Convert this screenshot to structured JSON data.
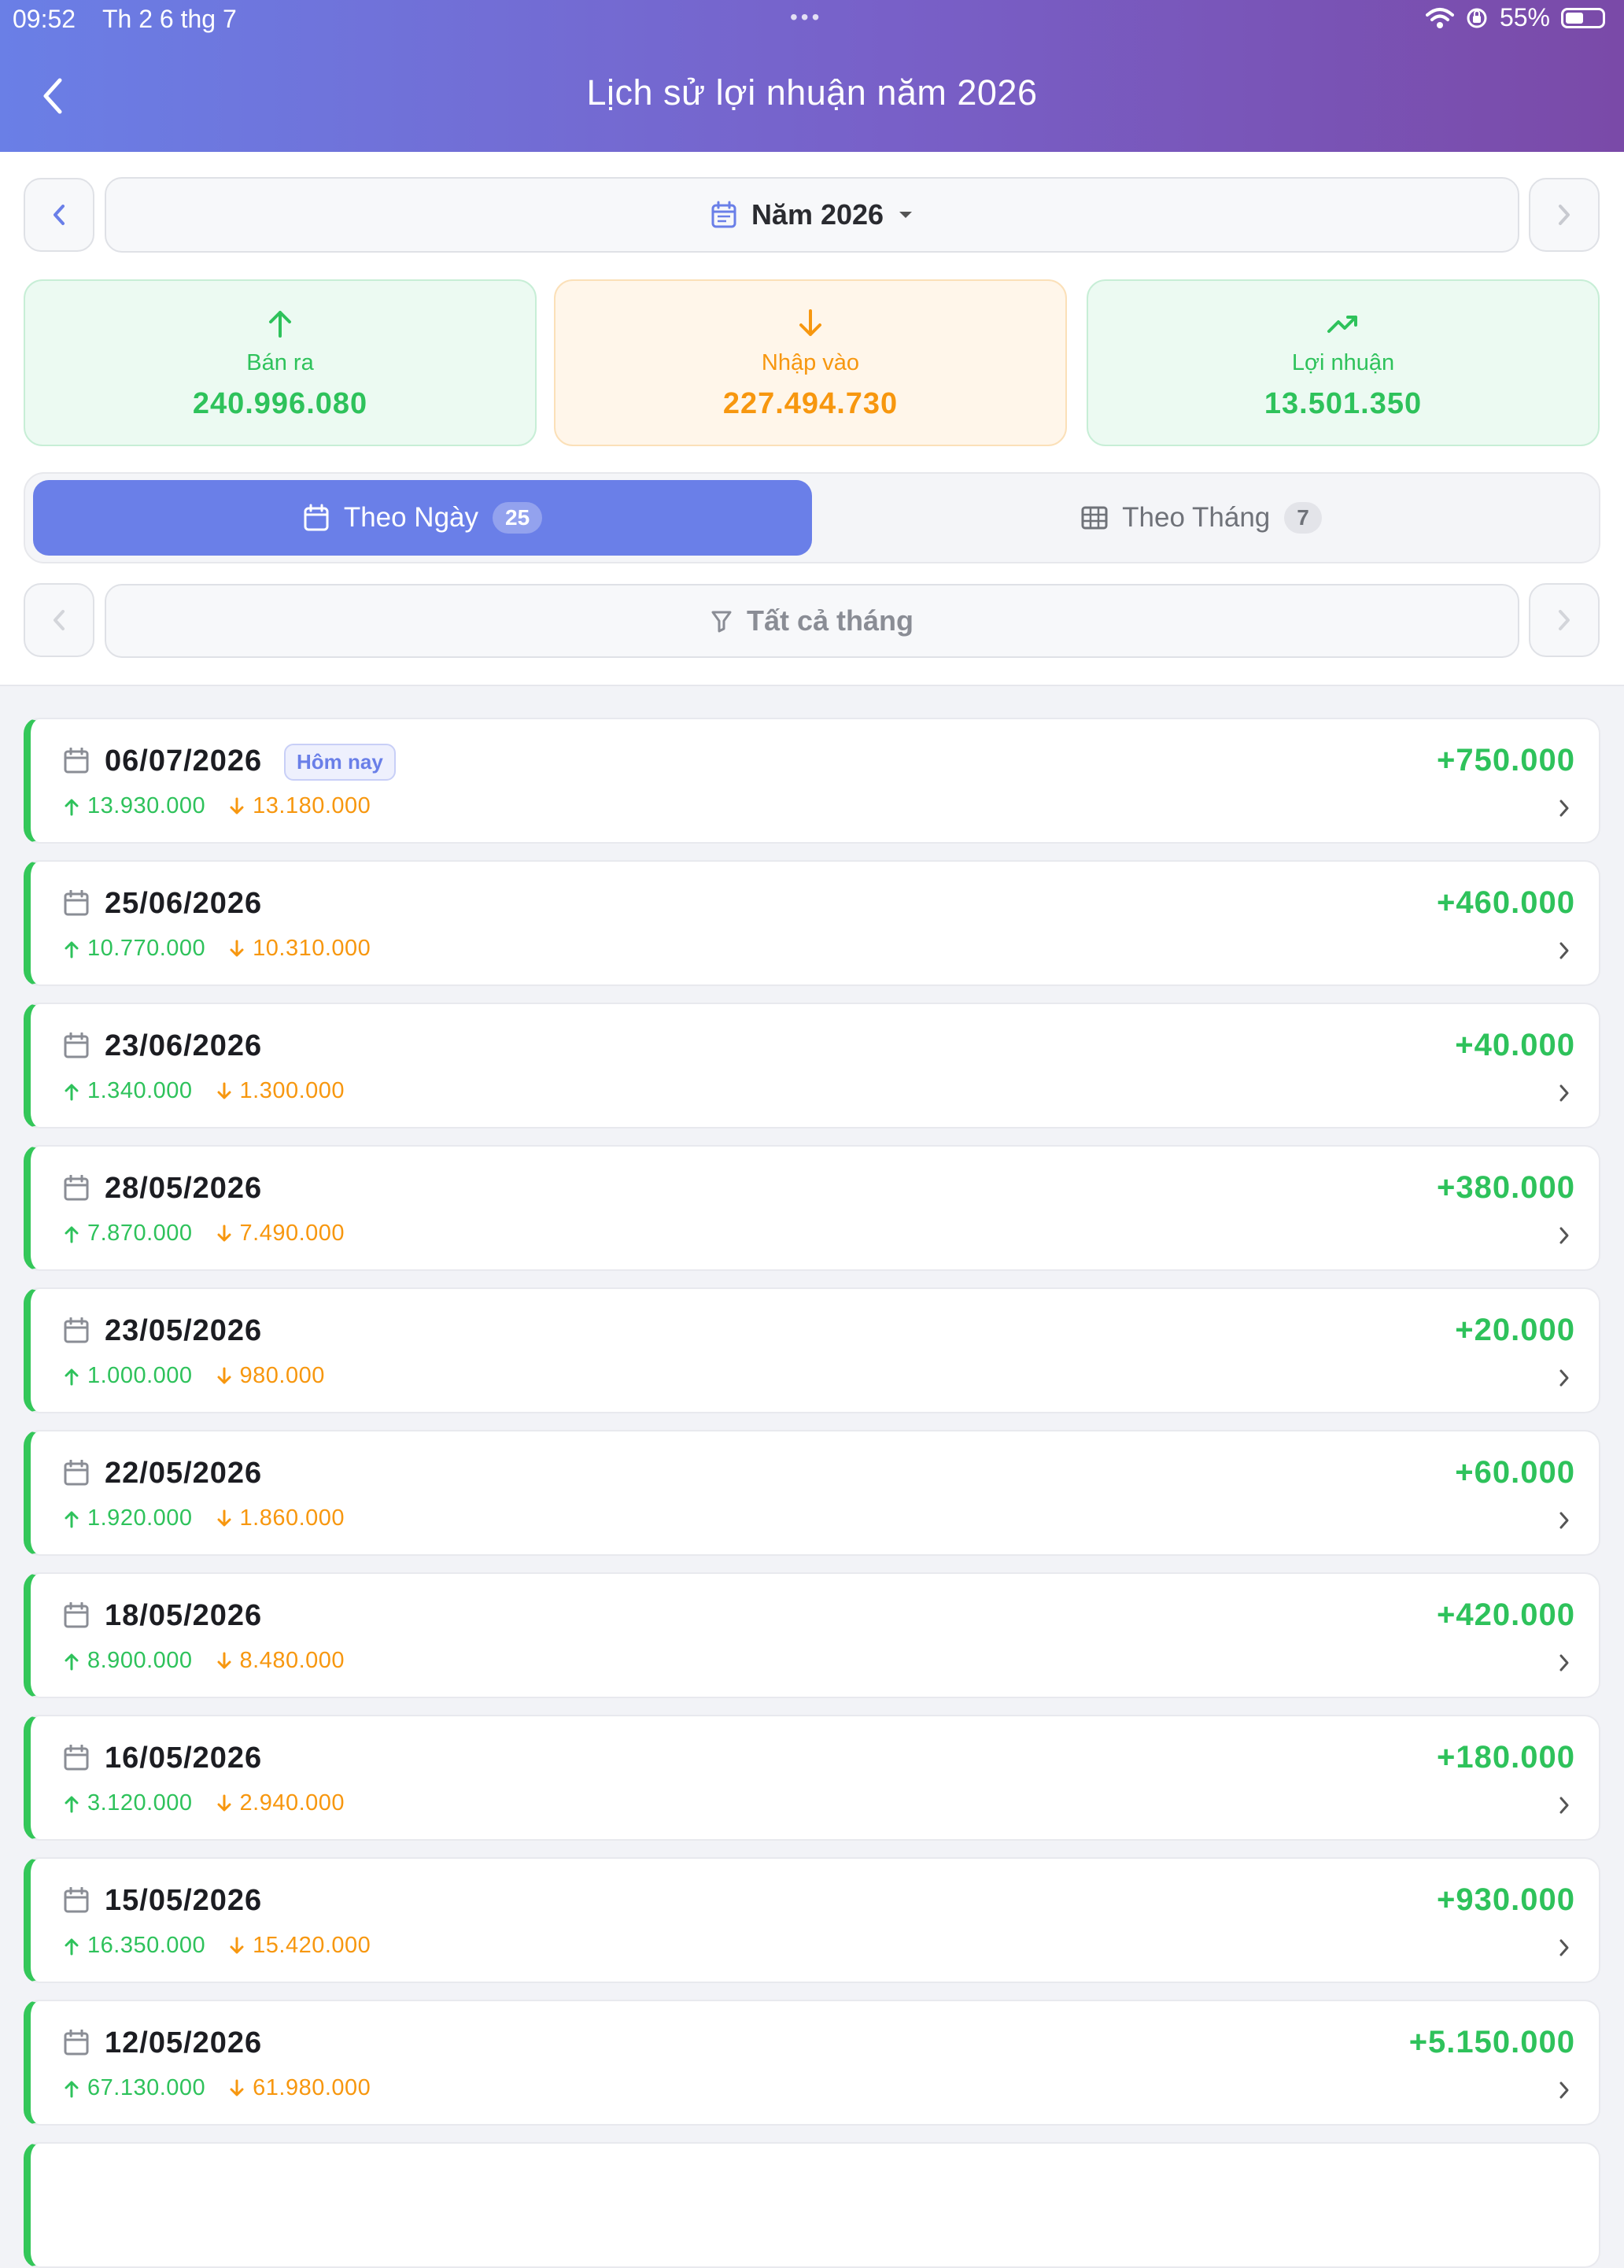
{
  "status_bar": {
    "time": "09:52",
    "date": "Th 2 6 thg 7",
    "dots": "•••",
    "battery": "55%",
    "battery_level": 0.55
  },
  "header": {
    "title": "Lịch sử lợi nhuận năm 2026"
  },
  "year_selector": {
    "label": "Năm 2026"
  },
  "stats": {
    "sell": {
      "label": "Bán ra",
      "value": "240.996.080"
    },
    "buy": {
      "label": "Nhập vào",
      "value": "227.494.730"
    },
    "profit": {
      "label": "Lợi nhuận",
      "value": "13.501.350"
    }
  },
  "tabs": [
    {
      "label": "Theo Ngày",
      "count": "25",
      "active": true
    },
    {
      "label": "Theo Tháng",
      "count": "7",
      "active": false
    }
  ],
  "filter": {
    "label": "Tất cả tháng"
  },
  "today_badge": "Hôm nay",
  "colors": {
    "accent": "#6a7fe8",
    "green": "#2ec25b",
    "orange": "#f7970f"
  },
  "rows": [
    {
      "date": "06/07/2026",
      "profit": "+750.000",
      "in": "13.930.000",
      "out": "13.180.000",
      "today": true
    },
    {
      "date": "25/06/2026",
      "profit": "+460.000",
      "in": "10.770.000",
      "out": "10.310.000"
    },
    {
      "date": "23/06/2026",
      "profit": "+40.000",
      "in": "1.340.000",
      "out": "1.300.000"
    },
    {
      "date": "28/05/2026",
      "profit": "+380.000",
      "in": "7.870.000",
      "out": "7.490.000"
    },
    {
      "date": "23/05/2026",
      "profit": "+20.000",
      "in": "1.000.000",
      "out": "980.000"
    },
    {
      "date": "22/05/2026",
      "profit": "+60.000",
      "in": "1.920.000",
      "out": "1.860.000"
    },
    {
      "date": "18/05/2026",
      "profit": "+420.000",
      "in": "8.900.000",
      "out": "8.480.000"
    },
    {
      "date": "16/05/2026",
      "profit": "+180.000",
      "in": "3.120.000",
      "out": "2.940.000"
    },
    {
      "date": "15/05/2026",
      "profit": "+930.000",
      "in": "16.350.000",
      "out": "15.420.000"
    },
    {
      "date": "12/05/2026",
      "profit": "+5.150.000",
      "in": "67.130.000",
      "out": "61.980.000"
    }
  ]
}
